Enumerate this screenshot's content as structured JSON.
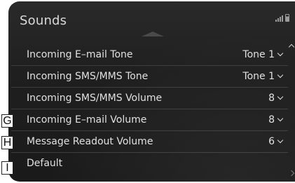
{
  "header": {
    "title": "Sounds"
  },
  "settings": [
    {
      "label": "Incoming E–mail Tone",
      "value": "Tone 1"
    },
    {
      "label": "Incoming SMS/MMS Tone",
      "value": "Tone 1"
    },
    {
      "label": "Incoming SMS/MMS Volume",
      "value": "8"
    },
    {
      "label": "Incoming E–mail Volume",
      "value": "8"
    },
    {
      "label": "Message Readout Volume",
      "value": "6"
    },
    {
      "label": "Default",
      "value": ""
    }
  ],
  "callouts": {
    "g": "G",
    "h": "H",
    "i": "I"
  },
  "icons": {
    "status": [
      "signal-icon",
      "battery-icon"
    ],
    "value": "chevron-down-icon",
    "scroll": [
      "scroll-up-icon",
      "scroll-down-icon"
    ]
  },
  "colors": {
    "screen_background": "#1f1f1f",
    "text": "#e0e0e0",
    "divider": "#3d3d3d"
  }
}
